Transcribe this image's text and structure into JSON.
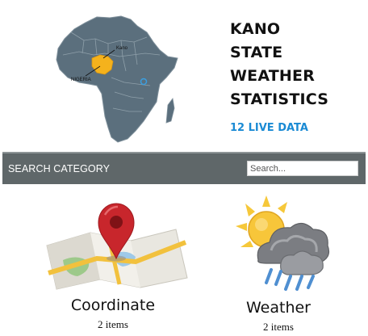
{
  "header": {
    "title_lines": [
      "KANO",
      "STATE",
      "WEATHER",
      "STATISTICS"
    ],
    "live_data": "12 LIVE DATA",
    "map": {
      "label_kano": "Kano",
      "label_nigeria": "NIGERIA",
      "icon": "africa-map-icon"
    }
  },
  "search": {
    "label": "SEARCH CATEGORY",
    "placeholder": "Search...",
    "value": ""
  },
  "categories": [
    {
      "name": "Coordinate",
      "count": "2 items",
      "icon": "map-pin-icon"
    },
    {
      "name": "Weather",
      "count": "2 items",
      "icon": "weather-storm-icon"
    }
  ],
  "colors": {
    "accent": "#1a8ad4",
    "search_bar": "#5f6769",
    "map_fill": "#5b6f7d",
    "highlight": "#f5b21c",
    "pin": "#c8262c"
  }
}
